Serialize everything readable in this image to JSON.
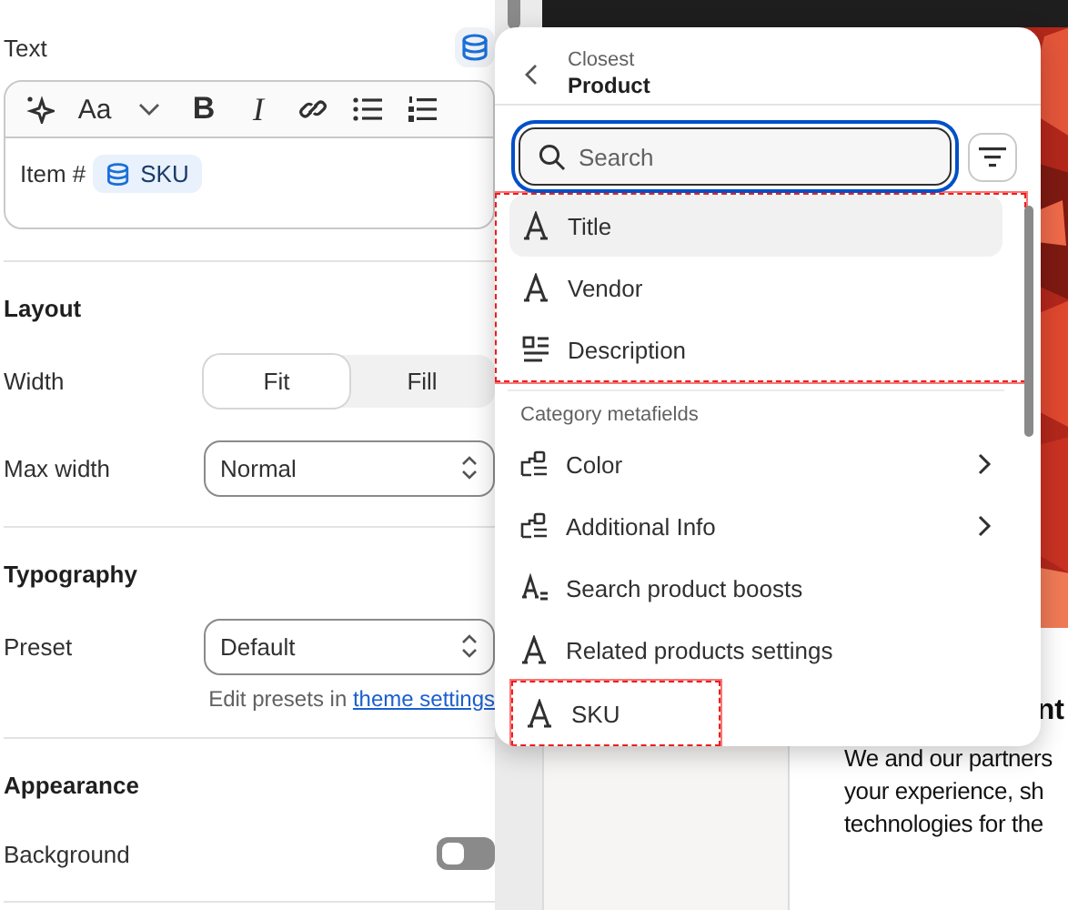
{
  "editor": {
    "label": "Text",
    "toolbar": [
      {
        "kind": "sparkle"
      },
      {
        "kind": "font",
        "label": "Aa"
      },
      {
        "kind": "caret"
      },
      {
        "kind": "bold",
        "label": "B"
      },
      {
        "kind": "italic",
        "label": "I"
      },
      {
        "kind": "link"
      },
      {
        "kind": "bullets"
      },
      {
        "kind": "numbers"
      }
    ],
    "content": "Item #",
    "token": "SKU"
  },
  "layout": {
    "title": "Layout",
    "width": {
      "label": "Width",
      "options": [
        {
          "label": "Fit",
          "selected": true
        },
        {
          "label": "Fill",
          "selected": false
        }
      ]
    },
    "max_width": {
      "label": "Max width",
      "value": "Normal"
    }
  },
  "typography": {
    "title": "Typography",
    "preset": {
      "label": "Preset",
      "value": "Default"
    },
    "help": "Edit presets in",
    "help_link": "theme settings"
  },
  "appearance": {
    "title": "Appearance",
    "background": {
      "label": "Background",
      "on": false
    }
  },
  "picker": {
    "parent": "Closest",
    "title": "Product",
    "search": {
      "placeholder": "Search",
      "focused": true
    },
    "items": [
      {
        "kind": "text",
        "label": "Title",
        "selected": true,
        "annotated": true
      },
      {
        "kind": "text",
        "label": "Vendor",
        "selected": false,
        "annotated": true
      },
      {
        "kind": "richtext",
        "label": "Description",
        "selected": false,
        "annotated": true
      }
    ],
    "section": "Category metafields",
    "metafields": [
      {
        "kind": "group",
        "label": "Color",
        "selected": false,
        "annotated": false
      },
      {
        "kind": "group",
        "label": "Additional Info",
        "selected": false,
        "annotated": false
      },
      {
        "kind": "list",
        "label": "Search product boosts",
        "selected": false,
        "annotated": false
      },
      {
        "kind": "text",
        "label": "Related products settings",
        "selected": false,
        "annotated": false
      },
      {
        "kind": "text",
        "label": "SKU",
        "selected": false,
        "annotated": true
      }
    ]
  },
  "preview": {
    "heading": "nt",
    "lines": [
      "We and our partners",
      "your experience, sh",
      "technologies for the"
    ]
  }
}
